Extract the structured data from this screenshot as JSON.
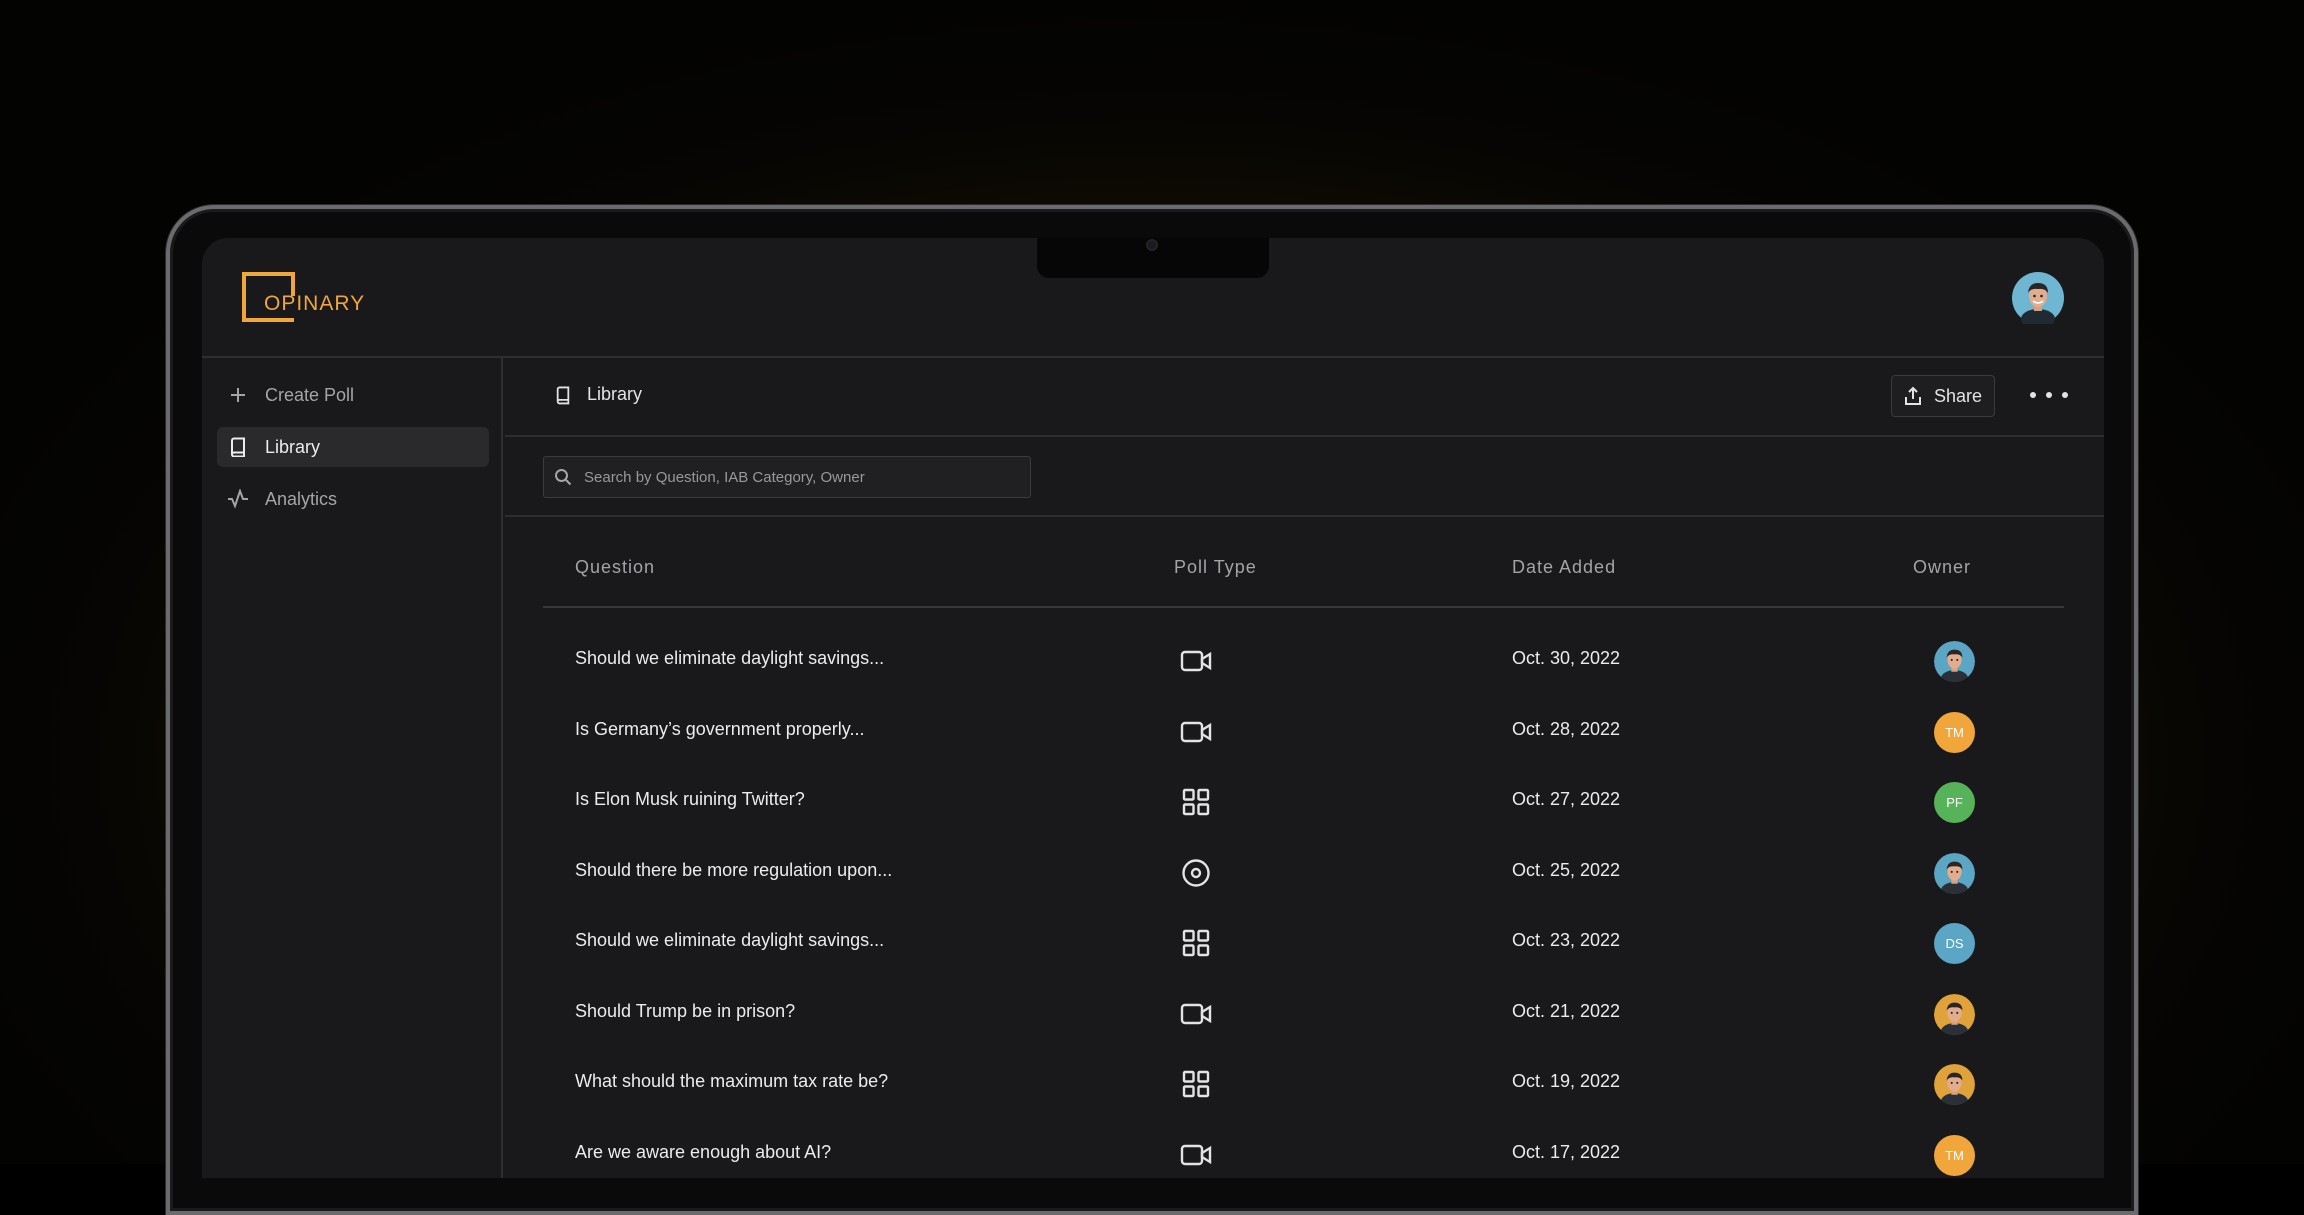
{
  "app": {
    "logo_text": "OPINARY",
    "brand_color": "#f0a63a"
  },
  "sidebar": {
    "items": [
      {
        "label": "Create Poll",
        "icon": "plus-icon",
        "active": false
      },
      {
        "label": "Library",
        "icon": "book-icon",
        "active": true
      },
      {
        "label": "Analytics",
        "icon": "activity-icon",
        "active": false
      }
    ]
  },
  "header": {
    "breadcrumb": "Library",
    "share_label": "Share",
    "more_icon": "more-horizontal-icon"
  },
  "search": {
    "placeholder": "Search by Question, IAB Category, Owner",
    "value": ""
  },
  "table": {
    "columns": [
      "Question",
      "Poll Type",
      "Date Added",
      "Owner"
    ],
    "rows": [
      {
        "question": "Should we eliminate daylight savings...",
        "type": "video-icon",
        "date": "Oct. 30, 2022",
        "owner": {
          "kind": "photo",
          "initials": "",
          "color": "#5aa6c4"
        }
      },
      {
        "question": "Is Germany’s government properly...",
        "type": "video-icon",
        "date": "Oct. 28, 2022",
        "owner": {
          "kind": "initials",
          "initials": "TM",
          "color": "#f0a63a"
        }
      },
      {
        "question": "Is Elon Musk ruining Twitter?",
        "type": "grid-icon",
        "date": "Oct. 27, 2022",
        "owner": {
          "kind": "initials",
          "initials": "PF",
          "color": "#57b35a"
        }
      },
      {
        "question": "Should there be more regulation upon...",
        "type": "target-icon",
        "date": "Oct. 25, 2022",
        "owner": {
          "kind": "photo",
          "initials": "",
          "color": "#5aa6c4"
        }
      },
      {
        "question": "Should we eliminate daylight savings...",
        "type": "grid-icon",
        "date": "Oct. 23, 2022",
        "owner": {
          "kind": "initials",
          "initials": "DS",
          "color": "#5aa6c4"
        }
      },
      {
        "question": "Should Trump be in prison?",
        "type": "video-icon",
        "date": "Oct. 21, 2022",
        "owner": {
          "kind": "photo",
          "initials": "",
          "color": "#e0a23a"
        }
      },
      {
        "question": "What should the maximum tax rate be?",
        "type": "grid-icon",
        "date": "Oct. 19, 2022",
        "owner": {
          "kind": "photo",
          "initials": "",
          "color": "#e0a23a"
        }
      },
      {
        "question": "Are we aware enough about AI?",
        "type": "video-icon",
        "date": "Oct. 17, 2022",
        "owner": {
          "kind": "initials",
          "initials": "TM",
          "color": "#f0a63a"
        }
      }
    ]
  }
}
